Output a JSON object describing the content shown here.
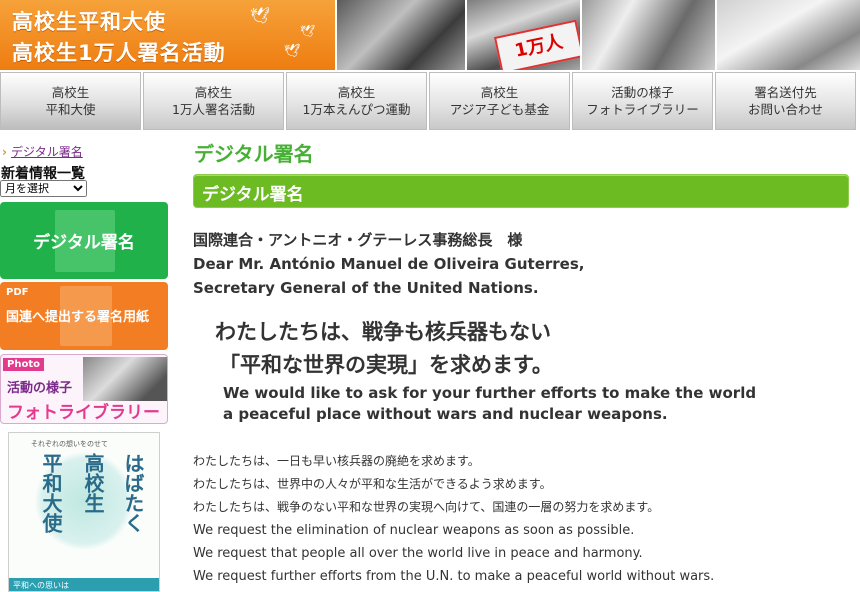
{
  "banner": {
    "title_line1": "高校生平和大使",
    "title_line2": "高校生1万人署名活動",
    "sign_text": "1万人",
    "colors": {
      "banner": "#f08a1c"
    }
  },
  "nav": {
    "items": [
      {
        "line1": "高校生",
        "line2": "平和大使"
      },
      {
        "line1": "高校生",
        "line2": "1万人署名活動"
      },
      {
        "line1": "高校生",
        "line2": "1万本えんぴつ運動"
      },
      {
        "line1": "高校生",
        "line2": "アジア子ども基金"
      },
      {
        "line1": "活動の様子",
        "line2": "フォトライブラリー"
      },
      {
        "line1": "署名送付先",
        "line2": "お問い合わせ"
      }
    ]
  },
  "sidebar": {
    "breadcrumb_arrow": "›",
    "breadcrumb": "デジタル署名",
    "news_heading": "新着情報一覧",
    "month_select": "月を選択",
    "btn_digital": "デジタル署名",
    "btn_pdf_tag": "PDF",
    "btn_pdf_label": "国連へ提出する署名用紙",
    "btn_photo_tag": "Photo",
    "btn_photo_line1": "活動の様子",
    "btn_photo_line2": "フォトライブラリー",
    "book": {
      "subtitle": "それぞれの想いをのせて",
      "col1": "はばたく",
      "col2": "高校生",
      "col3": "平和大使",
      "band": "平和への思いは"
    },
    "colors": {
      "digital": "#21b14b",
      "pdf": "#f27d22",
      "photo": "#e33a8e"
    }
  },
  "main": {
    "page_title": "デジタル署名",
    "section_title": "デジタル署名",
    "address": [
      "国際連合・アントニオ・グテーレス事務総長　様",
      "Dear Mr. António Manuel de Oliveira Guterres,",
      "Secretary General of the United Nations."
    ],
    "slogan": [
      "わたしたちは、戦争も核兵器もない",
      "「平和な世界の実現」を求めます。"
    ],
    "slogan_en": [
      "We would like to ask for your further efforts to make the world",
      "a peaceful place without wars and nuclear weapons."
    ],
    "requests_jp": [
      "わたしたちは、一日も早い核兵器の廃絶を求めます。",
      "わたしたちは、世界中の人々が平和な生活ができるよう求めます。",
      "わたしたちは、戦争のない平和な世界の実現へ向けて、国連の一層の努力を求めます。"
    ],
    "requests_en": [
      "We request the elimination of nuclear weapons as soon as possible.",
      "We request that people all over the world live in peace and harmony.",
      "We request further efforts from the U.N. to make a peaceful world without wars."
    ],
    "colors": {
      "title": "#46b034",
      "bar": "#6cbb22"
    }
  }
}
